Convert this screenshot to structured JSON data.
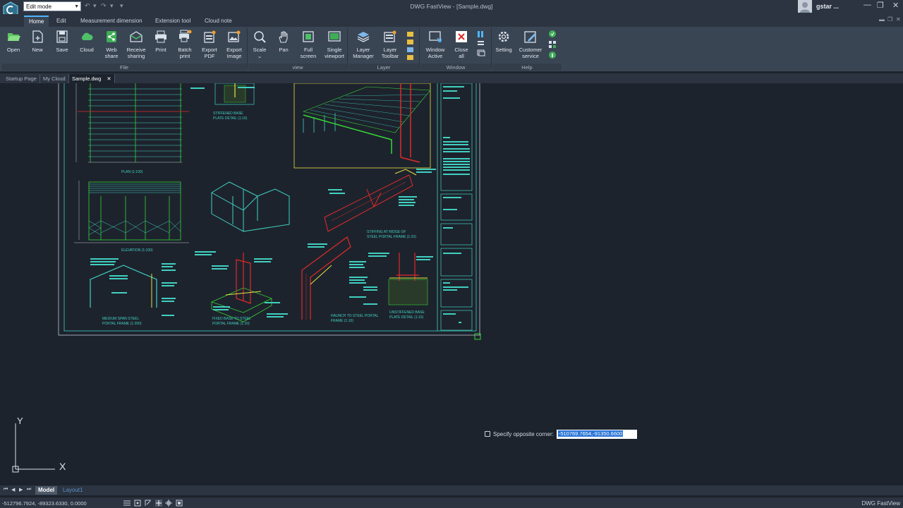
{
  "titlebar": {
    "mode": "Edit mode",
    "title": "DWG FastView - [Sample.dwg]",
    "user": "gstar ..."
  },
  "ribbon_tabs": [
    "Home",
    "Edit",
    "Measurement dimension",
    "Extension tool",
    "Cloud note"
  ],
  "ribbon": {
    "buttons": [
      {
        "label1": "Open",
        "label2": ""
      },
      {
        "label1": "New",
        "label2": ""
      },
      {
        "label1": "Save",
        "label2": ""
      },
      {
        "label1": "Cloud",
        "label2": ""
      },
      {
        "label1": "Web",
        "label2": "share"
      },
      {
        "label1": "Receive",
        "label2": "sharing"
      },
      {
        "label1": "Print",
        "label2": ""
      },
      {
        "label1": "Batch",
        "label2": "print"
      },
      {
        "label1": "Export",
        "label2": "PDF"
      },
      {
        "label1": "Export",
        "label2": "Image"
      },
      {
        "label1": "Scale",
        "label2": ""
      },
      {
        "label1": "Pan",
        "label2": ""
      },
      {
        "label1": "Full",
        "label2": "screen"
      },
      {
        "label1": "Single",
        "label2": "viewport"
      },
      {
        "label1": "Layer",
        "label2": "Manager"
      },
      {
        "label1": "Layer",
        "label2": "Toolbar"
      },
      {
        "label1": "Window",
        "label2": "Active"
      },
      {
        "label1": "Close",
        "label2": "all"
      },
      {
        "label1": "Setting",
        "label2": ""
      },
      {
        "label1": "Customer",
        "label2": "service"
      }
    ],
    "groups": [
      "File",
      "view",
      "Layer",
      "Window",
      "Help"
    ]
  },
  "doc_tabs": [
    "Startup Page",
    "My Cloud",
    "Sample.dwg"
  ],
  "drawing": {
    "labels": {
      "plan": "PLAN (1:100)",
      "elevation": "ELEVATION   (1:100)",
      "stiffened": "STIFFENED BASE",
      "stiffened2": "PLATE DETAIL (1:10)",
      "stiffing1": "STIFFING AT RIDGE OF",
      "stiffing2": "STEEL PORTAL FRAME (1:10)",
      "medium1": "MEDIUM  SPAN STEEL",
      "medium2": "PORTAL FRAME (1:200)",
      "fixed1": "FIXED BASE TO STEEL",
      "fixed2": "PORTAL FRAME (1:10)",
      "haunch1": "HAUNCH TO STEEL PORTAL",
      "haunch2": "FRAME (1:10)",
      "unstiff1": "UNSTIFFENED BASE",
      "unstiff2": "PLATE DETAIL (1:10)"
    },
    "ucs_x": "X",
    "ucs_y": "Y"
  },
  "command": {
    "prompt": "Specify opposite corner:",
    "value": "-510769.7654,-91350.6600"
  },
  "layout_tabs": [
    "Model",
    "Layout1"
  ],
  "status": {
    "coords": "-512796.7924, -89323.6330, 0.0000",
    "app": "DWG FastView"
  },
  "colors": {
    "accent": "#4fb6ff",
    "frame": "#40d0c0",
    "red": "#e02a2a",
    "green": "#35d635",
    "yellow": "#e8e040"
  }
}
